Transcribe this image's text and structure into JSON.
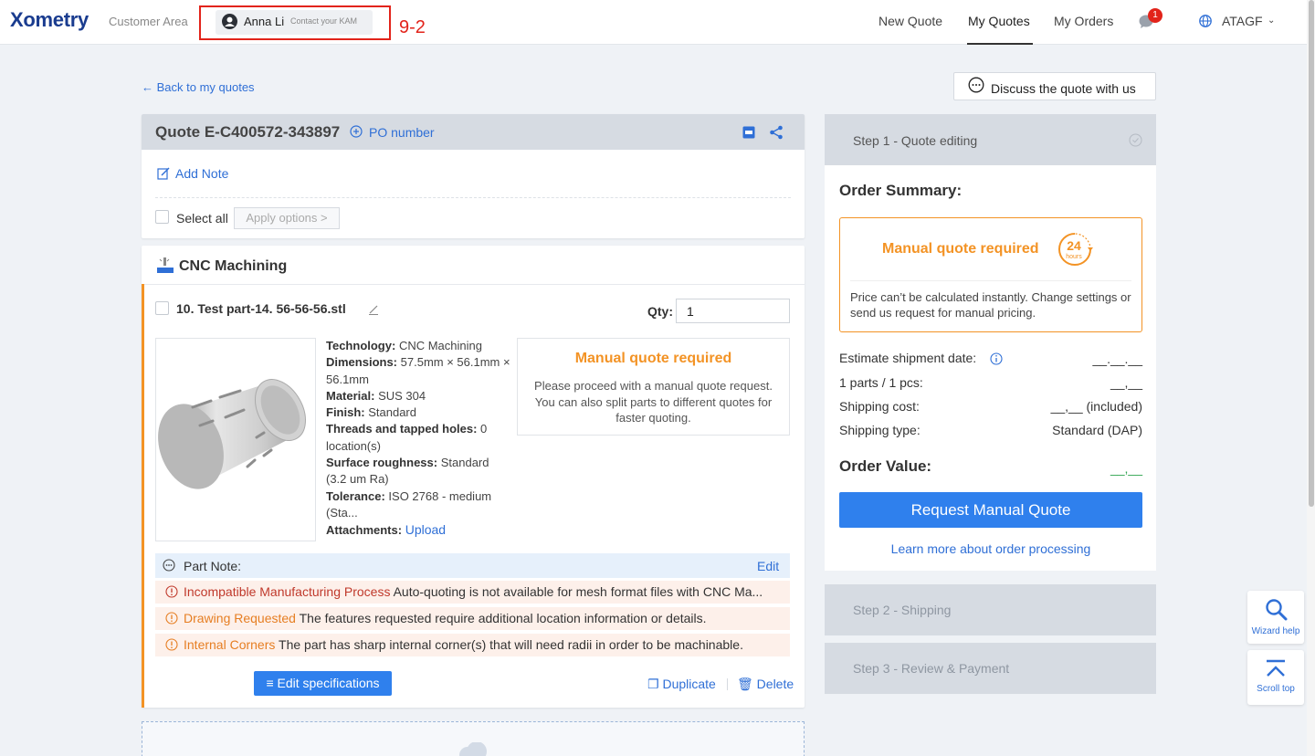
{
  "nav": {
    "logo": "Xometry",
    "customer_area": "Customer Area",
    "kam_name": "Anna Li",
    "kam_contact": "Contact your KAM",
    "annotation": "9-2",
    "links": [
      "New Quote",
      "My Quotes",
      "My Orders"
    ],
    "notification_count": "1",
    "account": "ATAGF"
  },
  "back_link": "← Back to my quotes",
  "discuss_button": "Discuss the quote with us",
  "quote": {
    "title": "Quote E-C400572-343897",
    "po_number": "PO number",
    "add_note": "Add Note",
    "select_all": "Select all",
    "apply_options": "Apply options >"
  },
  "process": {
    "title": "CNC Machining"
  },
  "part": {
    "name": "10. Test part-14. 56-56-56.stl",
    "qty_label": "Qty:",
    "qty_value": "1",
    "specs": [
      {
        "label": "Technology:",
        "value": "CNC Machining"
      },
      {
        "label": "Dimensions:",
        "value": "57.5mm × 56.1mm × 56.1mm"
      },
      {
        "label": "Material:",
        "value": "SUS 304"
      },
      {
        "label": "Finish:",
        "value": "Standard"
      },
      {
        "label": "Threads and tapped holes:",
        "value": "0 location(s)"
      },
      {
        "label": "Surface roughness:",
        "value": "Standard (3.2 um Ra)"
      },
      {
        "label": "Tolerance:",
        "value": "ISO 2768 - medium (Sta..."
      }
    ],
    "attachments_label": "Attachments:",
    "upload": "Upload",
    "manual_quote_title": "Manual quote required",
    "manual_quote_text": "Please proceed with a manual quote request. You can also split parts to different quotes for faster quoting.",
    "part_note_label": "Part Note:",
    "part_note_edit": "Edit",
    "warnings": [
      {
        "title": "Incompatible Manufacturing Process",
        "text": " Auto-quoting is not available for mesh format files with CNC Ma...",
        "tone": "red"
      },
      {
        "title": "Drawing Requested",
        "text": " The features requested require additional location information or details.",
        "tone": "orange"
      },
      {
        "title": "Internal Corners",
        "text": " The part has sharp internal corner(s) that will need radii in order to be machinable.",
        "tone": "orange"
      }
    ],
    "edit_specs": "≡ Edit specifications",
    "duplicate": "Duplicate",
    "delete": "Delete"
  },
  "steps": {
    "step1": "Step 1 - Quote editing",
    "step2": "Step 2 - Shipping",
    "step3": "Step 3 - Review & Payment"
  },
  "summary": {
    "title": "Order Summary:",
    "manual_title": "Manual quote required",
    "hours_number": "24",
    "hours_word": "hours",
    "manual_text": "Price can’t be calculated instantly. Change settings or send us request for manual pricing.",
    "rows": [
      {
        "label": "Estimate shipment date:",
        "value": "__.__.__"
      },
      {
        "label": "1 parts / 1 pcs:",
        "value": "__,__"
      },
      {
        "label": "Shipping cost:",
        "value": "__,__ (included)"
      },
      {
        "label": "Shipping type:",
        "value": "Standard (DAP)"
      }
    ],
    "order_value_label": "Order Value:",
    "order_value": "__,__",
    "request_button": "Request Manual Quote",
    "learn_more": "Learn more about order processing"
  },
  "helpers": {
    "wizard": "Wizard help",
    "scroll_top": "Scroll top"
  },
  "colors": {
    "brand_blue": "#2f80ed",
    "accent_orange": "#f39325",
    "alert_red": "#e2231a"
  }
}
